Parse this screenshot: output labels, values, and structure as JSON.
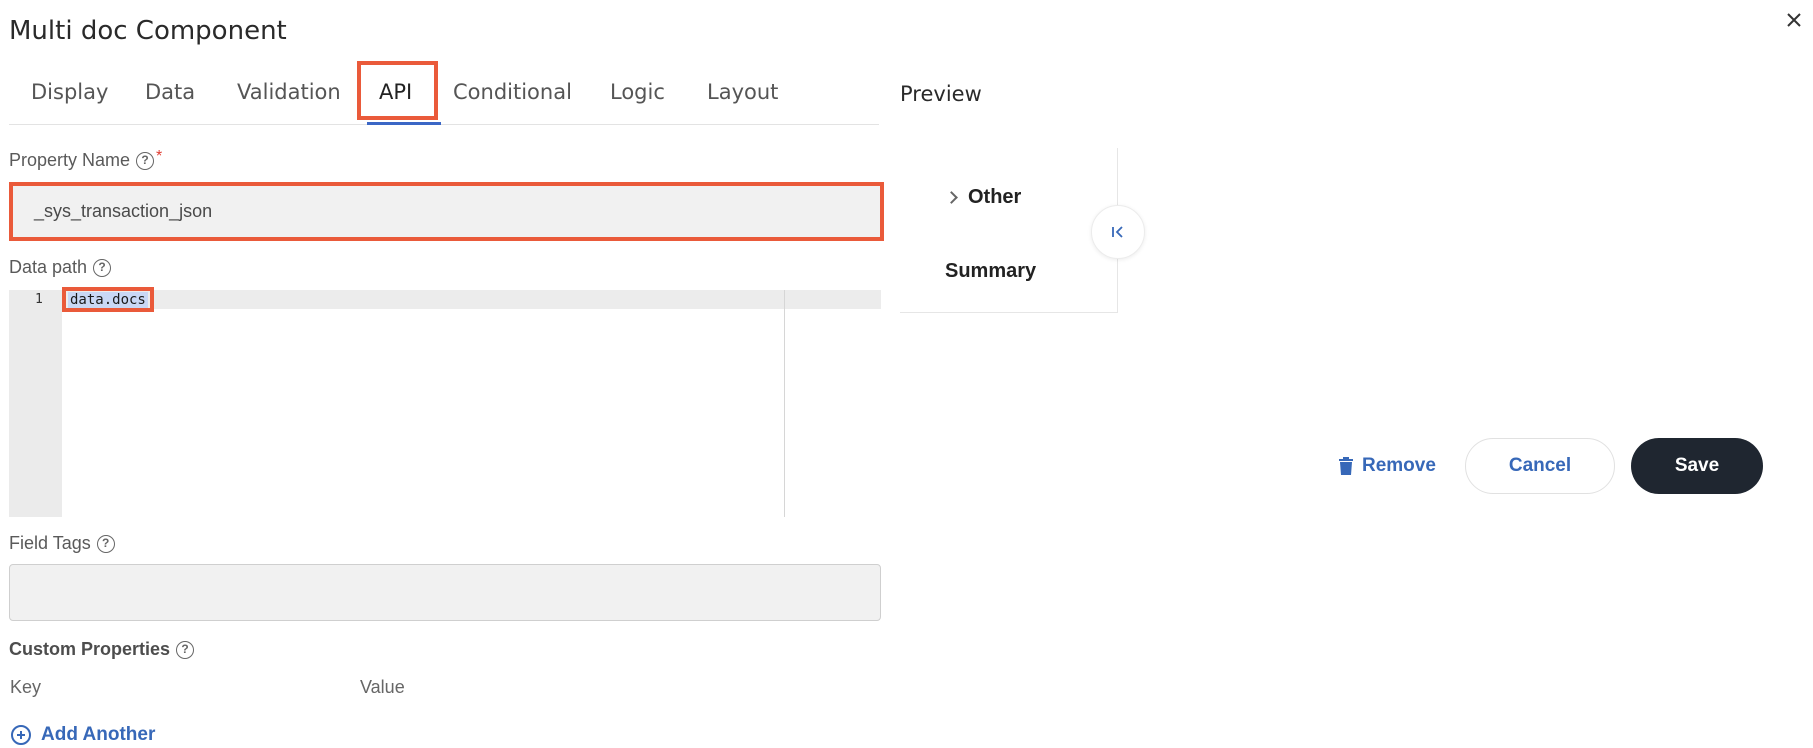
{
  "dialog": {
    "title": "Multi doc Component",
    "close_icon": "close-icon"
  },
  "tabs": [
    {
      "label": "Display"
    },
    {
      "label": "Data"
    },
    {
      "label": "Validation"
    },
    {
      "label": "API",
      "active": true
    },
    {
      "label": "Conditional"
    },
    {
      "label": "Logic"
    },
    {
      "label": "Layout"
    }
  ],
  "form": {
    "property_name": {
      "label": "Property Name",
      "required_mark": "*",
      "value": "_sys_transaction_json"
    },
    "data_path": {
      "label": "Data path",
      "line_number": "1",
      "value": "data.docs"
    },
    "field_tags": {
      "label": "Field Tags",
      "value": ""
    },
    "custom_properties": {
      "label": "Custom Properties",
      "key_header": "Key",
      "value_header": "Value",
      "add_label": "Add Another"
    }
  },
  "preview": {
    "title": "Preview",
    "other_label": "Other",
    "summary_label": "Summary"
  },
  "actions": {
    "remove_label": "Remove",
    "cancel_label": "Cancel",
    "save_label": "Save"
  },
  "colors": {
    "highlight": "#ea5a3a",
    "accent": "#3768b8",
    "save_bg": "#1f2630",
    "input_bg": "#f1f1f1"
  }
}
